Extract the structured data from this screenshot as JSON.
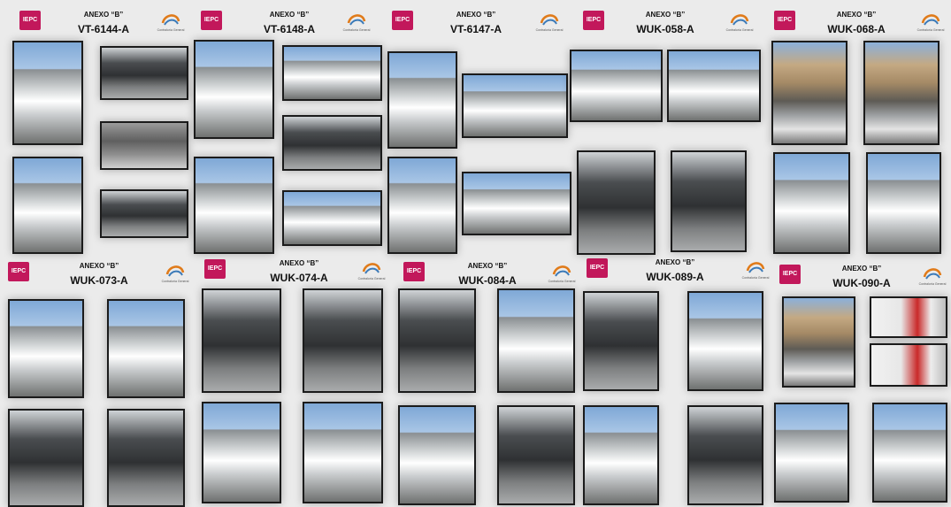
{
  "document": {
    "headers": [
      {
        "org": "IEPC",
        "annex": "ANEXO “B”",
        "code": "VT-6144-A",
        "corner_text": "Contraloría General"
      },
      {
        "org": "IEPC",
        "annex": "ANEXO “B”",
        "code": "VT-6148-A",
        "corner_text": "Contraloría General"
      },
      {
        "org": "IEPC",
        "annex": "ANEXO “B”",
        "code": "VT-6147-A",
        "corner_text": "Contraloría General"
      },
      {
        "org": "IEPC",
        "annex": "ANEXO “B”",
        "code": "WUK-058-A",
        "corner_text": "Contraloría General"
      },
      {
        "org": "IEPC",
        "annex": "ANEXO “B”",
        "code": "WUK-068-A",
        "corner_text": "Contraloría General"
      },
      {
        "org": "IEPC",
        "annex": "ANEXO “B”",
        "code": "WUK-073-A",
        "corner_text": "Contraloría General"
      },
      {
        "org": "IEPC",
        "annex": "ANEXO “B”",
        "code": "WUK-074-A",
        "corner_text": "Contraloría General"
      },
      {
        "org": "IEPC",
        "annex": "ANEXO “B”",
        "code": "WUK-084-A",
        "corner_text": "Contraloría General"
      },
      {
        "org": "IEPC",
        "annex": "ANEXO “B”",
        "code": "WUK-089-A",
        "corner_text": "Contraloría General"
      },
      {
        "org": "IEPC",
        "annex": "ANEXO “B”",
        "code": "WUK-090-A",
        "corner_text": "Contraloría General"
      }
    ]
  },
  "colors": {
    "logo_magenta": "#c2185b",
    "frame": "#1b1b1b",
    "background": "#ebebeb"
  }
}
